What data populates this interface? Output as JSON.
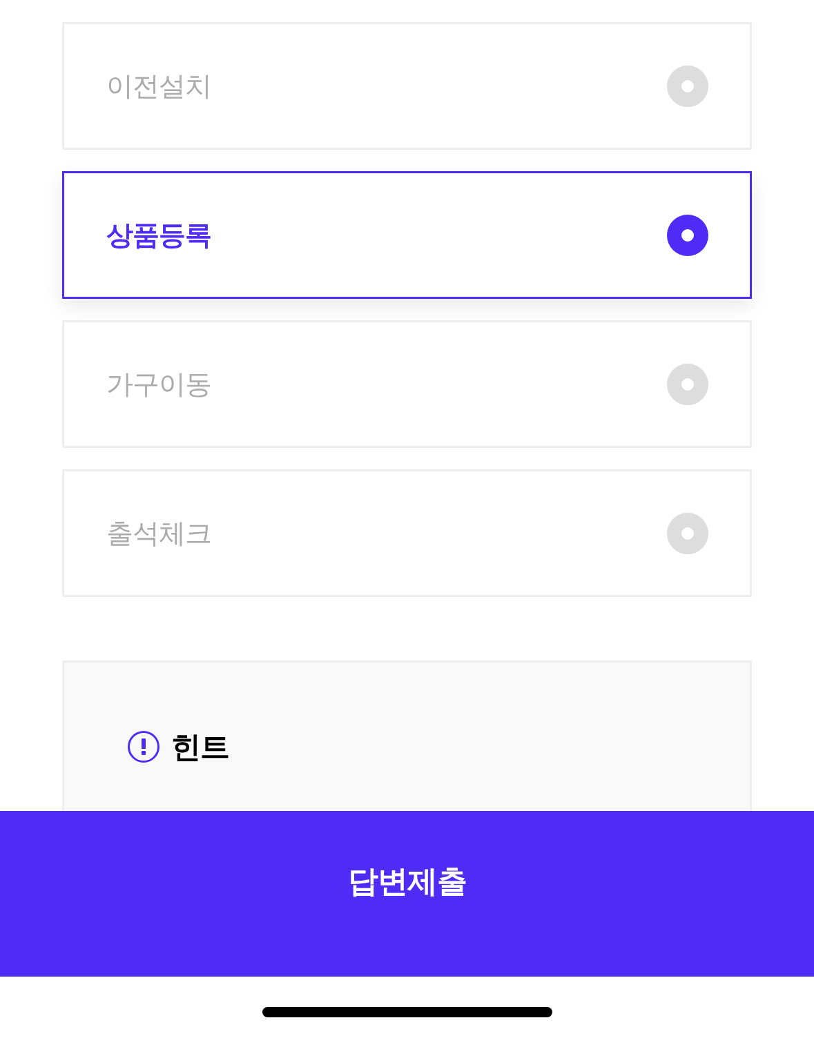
{
  "options": [
    {
      "label": "이전설치",
      "selected": false
    },
    {
      "label": "상품등록",
      "selected": true
    },
    {
      "label": "가구이동",
      "selected": false
    },
    {
      "label": "출석체크",
      "selected": false
    }
  ],
  "hint": {
    "title": "힌트"
  },
  "submit_button": {
    "label": "답변제출"
  }
}
